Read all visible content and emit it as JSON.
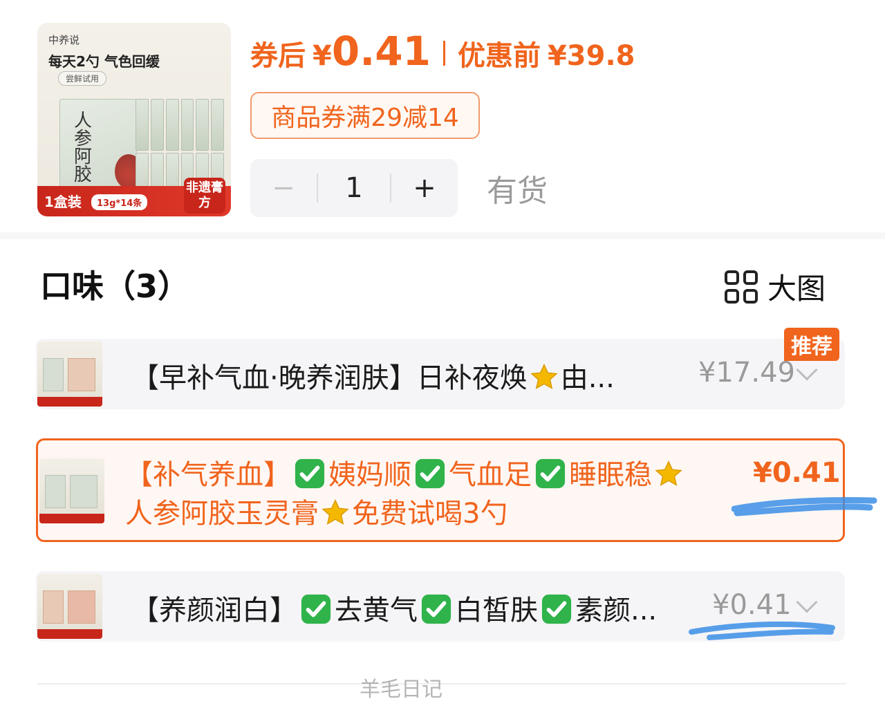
{
  "product": {
    "brand": "中养说",
    "tagline": "每天2勺 气色回缓",
    "trial_label": "尝鲜试用",
    "box_text": "人参阿胶",
    "pack_label": "1盒装",
    "spec_label": "13g*14条",
    "heritage_label": "非遗膏方"
  },
  "pricing": {
    "after_coupon_label": "券后",
    "after_coupon_currency": "¥",
    "after_coupon_value": "0.41",
    "before_label": "优惠前",
    "before_currency": "¥",
    "before_value": "39.8",
    "coupon_text": "商品券满29减14"
  },
  "quantity": {
    "minus": "−",
    "value": "1",
    "plus": "+"
  },
  "stock_status": "有货",
  "flavor_section": {
    "title": "口味（3）",
    "big_pic_label": "大图"
  },
  "options": [
    {
      "text": "【早补气血·晚养润肤】日补夜焕⭐由...",
      "price": "¥17.49",
      "badge": "推荐",
      "selected": false
    },
    {
      "text": "【补气养血】✅姨妈顺✅气血足✅睡眠稳⭐人参阿胶玉灵膏⭐免费试喝3勺",
      "price": "¥0.41",
      "selected": true
    },
    {
      "text": "【养颜润白】✅去黄气✅白皙肤✅素颜...",
      "price": "¥0.41",
      "selected": false
    }
  ],
  "watermark": "羊毛日记",
  "colors": {
    "accent": "#f0641d",
    "option_bg": "#f5f5f7",
    "selected_bg": "#fff7f3",
    "check_green": "#2fb34a",
    "star_gold": "#f5b800",
    "scribble_blue": "#3b8ee6"
  }
}
